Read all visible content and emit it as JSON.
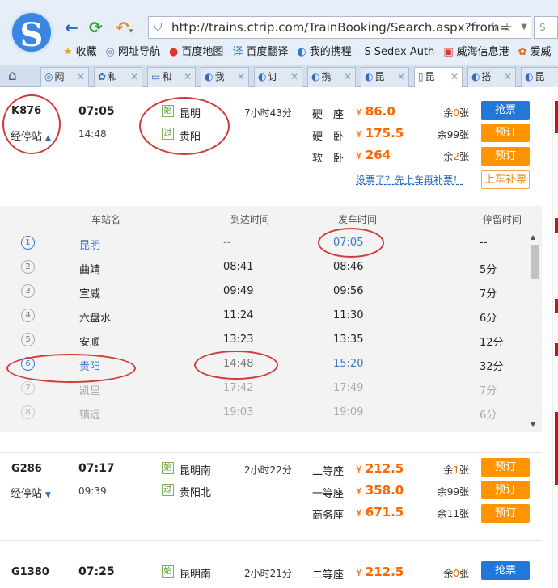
{
  "browser": {
    "url": "http://trains.ctrip.com/TrainBooking/Search.aspx?from=",
    "search_placeholder": "S",
    "bookmarks": [
      {
        "icon": "star-icon",
        "label": "收藏",
        "glyph": "★",
        "color": "#e6a817"
      },
      {
        "icon": "globe-icon",
        "label": "网址导航",
        "glyph": "◎",
        "color": "#5b7fa8"
      },
      {
        "icon": "map-pin-icon",
        "label": "百度地图",
        "glyph": "●",
        "color": "#d33"
      },
      {
        "icon": "translate-icon",
        "label": "百度翻译",
        "glyph": "译",
        "color": "#2a78d6"
      },
      {
        "icon": "ctrip-icon",
        "label": "我的携程-",
        "glyph": "◐",
        "color": "#2a78d6"
      },
      {
        "icon": "sedex-icon",
        "label": "Sedex Auth",
        "glyph": "S",
        "color": "#222"
      },
      {
        "icon": "gov-icon",
        "label": "威海信息港",
        "glyph": "▣",
        "color": "#d33"
      },
      {
        "icon": "flame-icon",
        "label": "爱威",
        "glyph": "✿",
        "color": "#e86a1a"
      }
    ],
    "tabs": [
      {
        "label": "网",
        "icon": "globe-icon",
        "glyph": "◎"
      },
      {
        "label": "和",
        "icon": "paw-icon",
        "glyph": "✿"
      },
      {
        "label": "和",
        "icon": "tv-icon",
        "glyph": "▭"
      },
      {
        "label": "我",
        "icon": "ctrip-icon",
        "glyph": "◐"
      },
      {
        "label": "订",
        "icon": "ctrip-icon",
        "glyph": "◐"
      },
      {
        "label": "携",
        "icon": "ctrip-icon",
        "glyph": "◐"
      },
      {
        "label": "昆",
        "icon": "ctrip-icon",
        "glyph": "◐"
      },
      {
        "label": "昆",
        "icon": "page-icon",
        "glyph": "▯"
      },
      {
        "label": "搭",
        "icon": "ctrip-icon",
        "glyph": "◐"
      },
      {
        "label": "昆",
        "icon": "ctrip-icon",
        "glyph": "◐"
      }
    ]
  },
  "train1": {
    "code": "K876",
    "stops_label": "经停站",
    "depart": "07:05",
    "arrive": "14:48",
    "from_tag": "始",
    "from": "昆明",
    "to_tag": "过",
    "to": "贵阳",
    "duration": "7小时43分",
    "seats": [
      {
        "type": "硬　座",
        "price": "86.0",
        "left_pre": "余",
        "left_num": "0",
        "left_post": "张",
        "button": "抢票",
        "style": "blue"
      },
      {
        "type": "硬　卧",
        "price": "175.5",
        "left_pre": "余",
        "left_num": "99",
        "left_post": "张",
        "button": "预订",
        "style": "orange"
      },
      {
        "type": "软　卧",
        "price": "264",
        "left_pre": "余",
        "left_num": "2",
        "left_post": "张",
        "button": "预订",
        "style": "orange"
      }
    ],
    "no_ticket_link": "没票了？先上车再补票！",
    "board_button": "上车补票",
    "currency": "¥"
  },
  "stops": {
    "headers": {
      "name": "车站名",
      "arrive": "到达时间",
      "depart": "发车时间",
      "stay": "停留时间"
    },
    "rows": [
      {
        "n": "1",
        "name": "昆明",
        "arrive": "--",
        "depart": "07:05",
        "stay": "--"
      },
      {
        "n": "2",
        "name": "曲靖",
        "arrive": "08:41",
        "depart": "08:46",
        "stay": "5分"
      },
      {
        "n": "3",
        "name": "宣威",
        "arrive": "09:49",
        "depart": "09:56",
        "stay": "7分"
      },
      {
        "n": "4",
        "name": "六盘水",
        "arrive": "11:24",
        "depart": "11:30",
        "stay": "6分"
      },
      {
        "n": "5",
        "name": "安顺",
        "arrive": "13:23",
        "depart": "13:35",
        "stay": "12分"
      },
      {
        "n": "6",
        "name": "贵阳",
        "arrive": "14:48",
        "depart": "15:20",
        "stay": "32分"
      },
      {
        "n": "7",
        "name": "凯里",
        "arrive": "17:42",
        "depart": "17:49",
        "stay": "7分"
      },
      {
        "n": "8",
        "name": "镇远",
        "arrive": "19:03",
        "depart": "19:09",
        "stay": "6分"
      }
    ]
  },
  "train2": {
    "code": "G286",
    "stops_label": "经停站",
    "depart": "07:17",
    "arrive": "09:39",
    "from_tag": "始",
    "from": "昆明南",
    "to_tag": "过",
    "to": "贵阳北",
    "duration": "2小时22分",
    "seats": [
      {
        "type": "二等座",
        "price": "212.5",
        "left_pre": "余",
        "left_num": "1",
        "left_post": "张",
        "button": "预订",
        "style": "orange"
      },
      {
        "type": "一等座",
        "price": "358.0",
        "left_pre": "余",
        "left_num": "99",
        "left_post": "张",
        "button": "预订",
        "style": "orange"
      },
      {
        "type": "商务座",
        "price": "671.5",
        "left_pre": "余",
        "left_num": "11",
        "left_post": "张",
        "button": "预订",
        "style": "orange"
      }
    ]
  },
  "train3": {
    "code": "G1380",
    "depart": "07:25",
    "from_tag": "始",
    "from": "昆明南",
    "duration": "2小时21分",
    "seats": [
      {
        "type": "二等座",
        "price": "212.5",
        "left_pre": "余",
        "left_num": "0",
        "left_post": "张",
        "button": "抢票",
        "style": "blue"
      }
    ]
  },
  "colors": {
    "accent_orange": "#ff6600",
    "book_orange": "#ff9400",
    "grab_blue": "#2277d8",
    "annotation_red": "#d33b3b"
  }
}
